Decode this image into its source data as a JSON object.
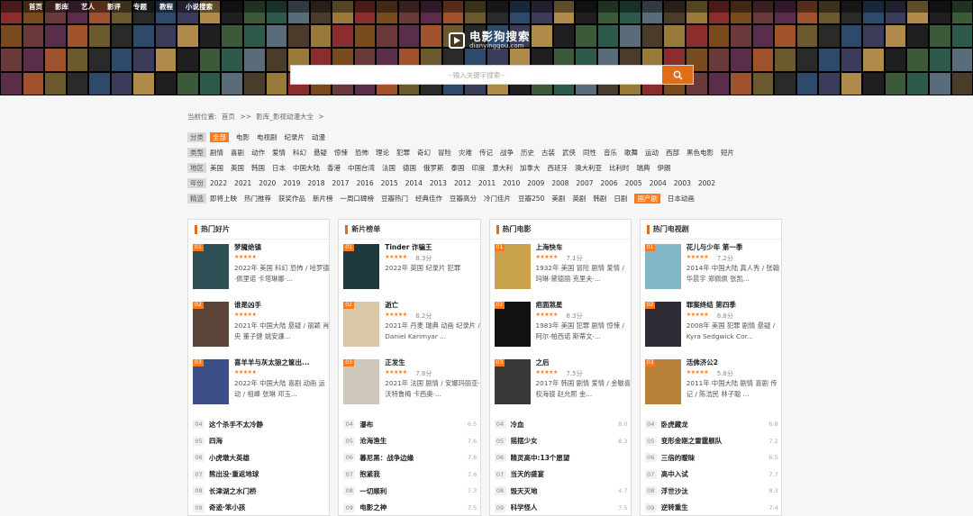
{
  "topnav": [
    "首页",
    "影库",
    "艺人",
    "影评",
    "专题",
    "教程",
    "小说搜索"
  ],
  "brand": {
    "title": "电影狗搜索",
    "sub": "dianyinggou.com"
  },
  "search": {
    "placeholder": "--输入关键字搜索--"
  },
  "breadcrumb": {
    "prefix": "当前位置:",
    "home": "首页",
    "sep": ">>",
    "section": "影库_影视动漫大全",
    "tail": ">"
  },
  "filters": [
    {
      "label": "分类",
      "items": [
        "全部",
        "电影",
        "电视剧",
        "纪录片",
        "动漫"
      ],
      "active": 0
    },
    {
      "label": "类型",
      "items": [
        "剧情",
        "喜剧",
        "动作",
        "爱情",
        "科幻",
        "悬疑",
        "惊悚",
        "恐怖",
        "理论",
        "犯罪",
        "奇幻",
        "冒险",
        "灾难",
        "传记",
        "战争",
        "历史",
        "古装",
        "武侠",
        "同性",
        "音乐",
        "歌舞",
        "运动",
        "西部",
        "黑色电影",
        "短片"
      ],
      "active": -1
    },
    {
      "label": "地区",
      "items": [
        "美国",
        "英国",
        "韩国",
        "日本",
        "中国大陆",
        "香港",
        "中国台湾",
        "法国",
        "德国",
        "俄罗斯",
        "泰国",
        "印度",
        "意大利",
        "加拿大",
        "西班牙",
        "澳大利亚",
        "比利时",
        "瑞典",
        "伊朗"
      ],
      "active": -1
    },
    {
      "label": "年份",
      "items": [
        "2022",
        "2021",
        "2020",
        "2019",
        "2018",
        "2017",
        "2016",
        "2015",
        "2014",
        "2013",
        "2012",
        "2011",
        "2010",
        "2009",
        "2008",
        "2007",
        "2006",
        "2005",
        "2004",
        "2003",
        "2002"
      ],
      "active": -1
    },
    {
      "label": "精选",
      "items": [
        "即将上映",
        "热门推荐",
        "获奖作品",
        "新片榜",
        "一周口碑榜",
        "豆瓣热门",
        "经典佳作",
        "豆瓣高分",
        "冷门佳片",
        "豆瓣250",
        "美剧",
        "英剧",
        "韩剧",
        "日剧",
        "国产剧",
        "日本动画"
      ],
      "active": 14
    }
  ],
  "panels": [
    {
      "title": "热门好片",
      "featured": [
        {
          "rank": "01",
          "title": "梦魇绝镇",
          "stars": "★★★★★",
          "score": "",
          "desc": "2022年 美国 科幻 恐怖 / 哈罗德·佩里诺 卡塔琳娜·...",
          "poster": "#2f4f57"
        },
        {
          "rank": "02",
          "title": "谁是凶手",
          "stars": "★★★★★",
          "score": "",
          "desc": "2021年 中国大陆 悬疑 / 丽颖 肖央 董子健 姚安濂...",
          "poster": "#5d4438"
        },
        {
          "rank": "03",
          "title": "喜羊羊与灰太狼之筐出...",
          "stars": "★★★★★",
          "score": "",
          "desc": "2022年 中国大陆 喜剧 动画 运动 / 祖峰 张琳 邓玉...",
          "poster": "#3b4f86"
        }
      ],
      "rows": [
        {
          "num": "04",
          "name": "这个杀手不太冷静",
          "score": ""
        },
        {
          "num": "05",
          "name": "四海",
          "score": ""
        },
        {
          "num": "06",
          "name": "小虎墩大英雄",
          "score": ""
        },
        {
          "num": "07",
          "name": "熊出没·重返地球",
          "score": ""
        },
        {
          "num": "08",
          "name": "长津湖之水门桥",
          "score": ""
        },
        {
          "num": "09",
          "name": "奇迹·笨小孩",
          "score": ""
        }
      ]
    },
    {
      "title": "新片榜单",
      "featured": [
        {
          "rank": "01",
          "title": "Tinder 诈骗王",
          "stars": "★★★★★",
          "score": "8.3分",
          "desc": "2022年 英国 纪录片 犯罪",
          "poster": "#1c3a3d"
        },
        {
          "rank": "02",
          "title": "逝亡",
          "stars": "★★★★★",
          "score": "8.2分",
          "desc": "2021年 丹麦 瑞典 动画 纪录片 / Daniel Karimyar ...",
          "poster": "#d9c9a8"
        },
        {
          "rank": "03",
          "title": "正发生",
          "stars": "★★★★★",
          "score": "7.8分",
          "desc": "2021年 法国 剧情 / 安娜玛丽亚·沃特鲁梅 卡西奥·...",
          "poster": "#cfc7bb"
        }
      ],
      "rows": [
        {
          "num": "04",
          "name": "瀑布",
          "score": "6.5"
        },
        {
          "num": "05",
          "name": "沧海渔生",
          "score": "7.6"
        },
        {
          "num": "06",
          "name": "暮尼黑：战争边缘",
          "score": "7.6"
        },
        {
          "num": "07",
          "name": "抱紧我",
          "score": "7.6"
        },
        {
          "num": "08",
          "name": "一切顺利",
          "score": "7.3"
        },
        {
          "num": "09",
          "name": "电影之神",
          "score": "7.5"
        }
      ]
    },
    {
      "title": "热门电影",
      "featured": [
        {
          "rank": "01",
          "title": "上海快车",
          "stars": "★★★★★",
          "score": "7.1分",
          "desc": "1932年 美国 冒险 剧情 爱情 / 玛琳·黛德丽 克里夫·...",
          "poster": "#c9a14a"
        },
        {
          "rank": "02",
          "title": "疤面煞星",
          "stars": "★★★★★",
          "score": "8.3分",
          "desc": "1983年 美国 犯罪 剧情 惊悚 / 阿尔·帕西诺 斯蒂文·...",
          "poster": "#111111"
        },
        {
          "rank": "03",
          "title": "之后",
          "stars": "★★★★★",
          "score": "7.5分",
          "desc": "2017年 韩国 剧情 爱情 / 金敏喜 权海骁 赵允熙 金...",
          "poster": "#3a3838"
        }
      ],
      "rows": [
        {
          "num": "04",
          "name": "冷血",
          "score": "8.0"
        },
        {
          "num": "05",
          "name": "摇摆少女",
          "score": "8.3"
        },
        {
          "num": "06",
          "name": "精灵高中:13个愿望",
          "score": ""
        },
        {
          "num": "07",
          "name": "当天的盛宴",
          "score": ""
        },
        {
          "num": "08",
          "name": "毁天灭地",
          "score": "4.7"
        },
        {
          "num": "09",
          "name": "科学怪人",
          "score": "7.5"
        }
      ]
    },
    {
      "title": "热门电视剧",
      "featured": [
        {
          "rank": "01",
          "title": "花儿与少年 第一季",
          "stars": "★★★★★",
          "score": "7.2分",
          "desc": "2014年 中国大陆 真人秀 / 张翰 华晨宇 郑佩佩 张凯...",
          "poster": "#7fb7c7"
        },
        {
          "rank": "02",
          "title": "罪案终结 第四季",
          "stars": "★★★★★",
          "score": "8.8分",
          "desc": "2008年 美国 犯罪 剧情 悬疑 / Kyra Sedgwick Cor...",
          "poster": "#2d2a36"
        },
        {
          "rank": "03",
          "title": "活佛济公2",
          "stars": "★★★★★",
          "score": "5.8分",
          "desc": "2011年 中国大陆 剧情 喜剧 传记 / 陈浩民 林子聪 ...",
          "poster": "#b9823b"
        }
      ],
      "rows": [
        {
          "num": "04",
          "name": "卧虎藏龙",
          "score": "6.8"
        },
        {
          "num": "05",
          "name": "变形金刚之雷霆舰队",
          "score": "7.2"
        },
        {
          "num": "06",
          "name": "三倍的暧昧",
          "score": "6.5"
        },
        {
          "num": "07",
          "name": "高中入试",
          "score": "7.7"
        },
        {
          "num": "08",
          "name": "浮世沙汰",
          "score": "8.3"
        },
        {
          "num": "09",
          "name": "逆转重生",
          "score": "7.4"
        }
      ]
    }
  ],
  "poster_colors": [
    "#8b2d2d",
    "#2d4a6b",
    "#4a3b2a",
    "#6b5a2d",
    "#2d5a4a",
    "#5a2d4a",
    "#1f1f1f",
    "#7a4a1f",
    "#3b3b5a",
    "#9a7a3a",
    "#2a2a2a",
    "#5a6b7a",
    "#a0522d",
    "#3a5a3a",
    "#6a3a3a",
    "#b08a4a"
  ]
}
